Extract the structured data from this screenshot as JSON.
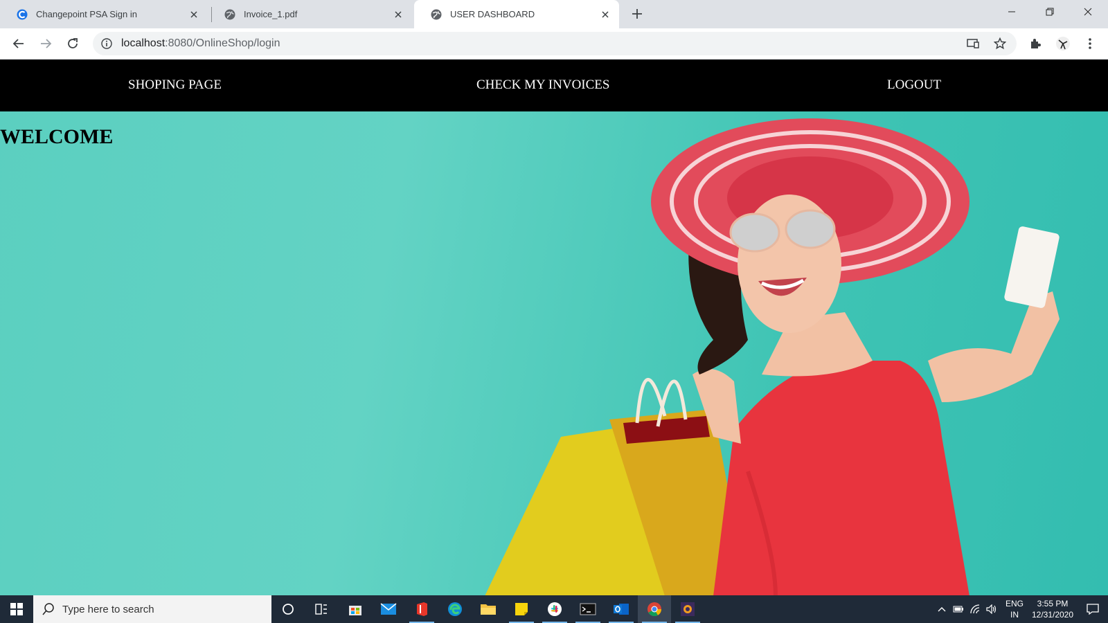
{
  "browser": {
    "tabs": [
      {
        "title": "Changepoint PSA Sign in",
        "icon": "changepoint-icon"
      },
      {
        "title": "Invoice_1.pdf",
        "icon": "globe-icon"
      },
      {
        "title": "USER DASHBOARD",
        "icon": "globe-icon",
        "active": true
      }
    ],
    "url_host": "localhost",
    "url_rest": ":8080/OnlineShop/login"
  },
  "page": {
    "nav": {
      "shopping": "SHOPING PAGE",
      "invoices": "CHECK MY INVOICES",
      "logout": "LOGOUT"
    },
    "heading": "WELCOME"
  },
  "taskbar": {
    "search_placeholder": "Type here to search",
    "lang_top": "ENG",
    "lang_bottom": "IN",
    "time": "3:55 PM",
    "date": "12/31/2020"
  },
  "colors": {
    "navbar": "#000000",
    "page_bg": "#5bcfc0",
    "taskbar": "#1f2a38"
  }
}
